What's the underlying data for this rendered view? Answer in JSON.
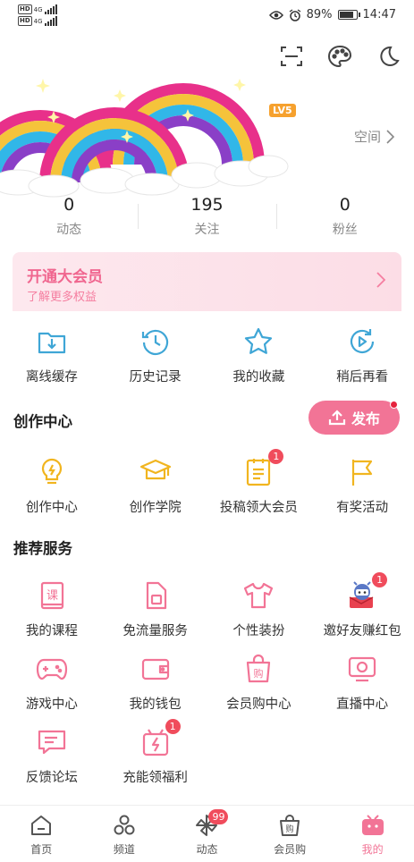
{
  "statusbar": {
    "sim1": "4G",
    "sim2": "4G",
    "battery": "89%",
    "battery_level": 0.89,
    "time": "14:47"
  },
  "profile": {
    "level": "LV5",
    "space_link": "空间"
  },
  "stats": [
    {
      "num": "0",
      "label": "动态"
    },
    {
      "num": "195",
      "label": "关注"
    },
    {
      "num": "0",
      "label": "粉丝"
    }
  ],
  "vip": {
    "title": "开通大会员",
    "subtitle": "了解更多权益"
  },
  "quick": [
    {
      "label": "离线缓存",
      "icon": "download-folder-icon"
    },
    {
      "label": "历史记录",
      "icon": "history-clock-icon"
    },
    {
      "label": "我的收藏",
      "icon": "star-icon"
    },
    {
      "label": "稍后再看",
      "icon": "watch-later-icon"
    }
  ],
  "creation": {
    "title": "创作中心",
    "publish_label": "发布",
    "items": [
      {
        "label": "创作中心",
        "icon": "lightbulb-icon",
        "badge": ""
      },
      {
        "label": "创作学院",
        "icon": "graduation-cap-icon",
        "badge": ""
      },
      {
        "label": "投稿领大会员",
        "icon": "document-icon",
        "badge": "1"
      },
      {
        "label": "有奖活动",
        "icon": "flag-icon",
        "badge": ""
      }
    ]
  },
  "services": {
    "title": "推荐服务",
    "items": [
      {
        "label": "我的课程",
        "icon": "course-book-icon",
        "badge": ""
      },
      {
        "label": "免流量服务",
        "icon": "sim-card-icon",
        "badge": ""
      },
      {
        "label": "个性装扮",
        "icon": "tshirt-icon",
        "badge": ""
      },
      {
        "label": "邀好友赚红包",
        "icon": "mascot-envelope-icon",
        "badge": "1"
      },
      {
        "label": "游戏中心",
        "icon": "gamepad-icon",
        "badge": ""
      },
      {
        "label": "我的钱包",
        "icon": "wallet-icon",
        "badge": ""
      },
      {
        "label": "会员购中心",
        "icon": "shopping-bag-icon",
        "badge": ""
      },
      {
        "label": "直播中心",
        "icon": "live-tv-icon",
        "badge": ""
      },
      {
        "label": "反馈论坛",
        "icon": "feedback-chat-icon",
        "badge": ""
      },
      {
        "label": "充能领福利",
        "icon": "charge-gift-icon",
        "badge": "1"
      }
    ]
  },
  "nav": [
    {
      "label": "首页",
      "icon": "home-icon",
      "badge": ""
    },
    {
      "label": "频道",
      "icon": "channel-circles-icon",
      "badge": ""
    },
    {
      "label": "动态",
      "icon": "pinwheel-icon",
      "badge": "99"
    },
    {
      "label": "会员购",
      "icon": "shop-bag-icon",
      "badge": ""
    },
    {
      "label": "我的",
      "icon": "tv-mascot-icon",
      "badge": ""
    }
  ],
  "colors": {
    "accent": "#f27496",
    "badge": "#f04c5c",
    "icon_blue": "#3fa6d6",
    "icon_yellow": "#f1b51f",
    "icon_pink": "#f27496"
  }
}
